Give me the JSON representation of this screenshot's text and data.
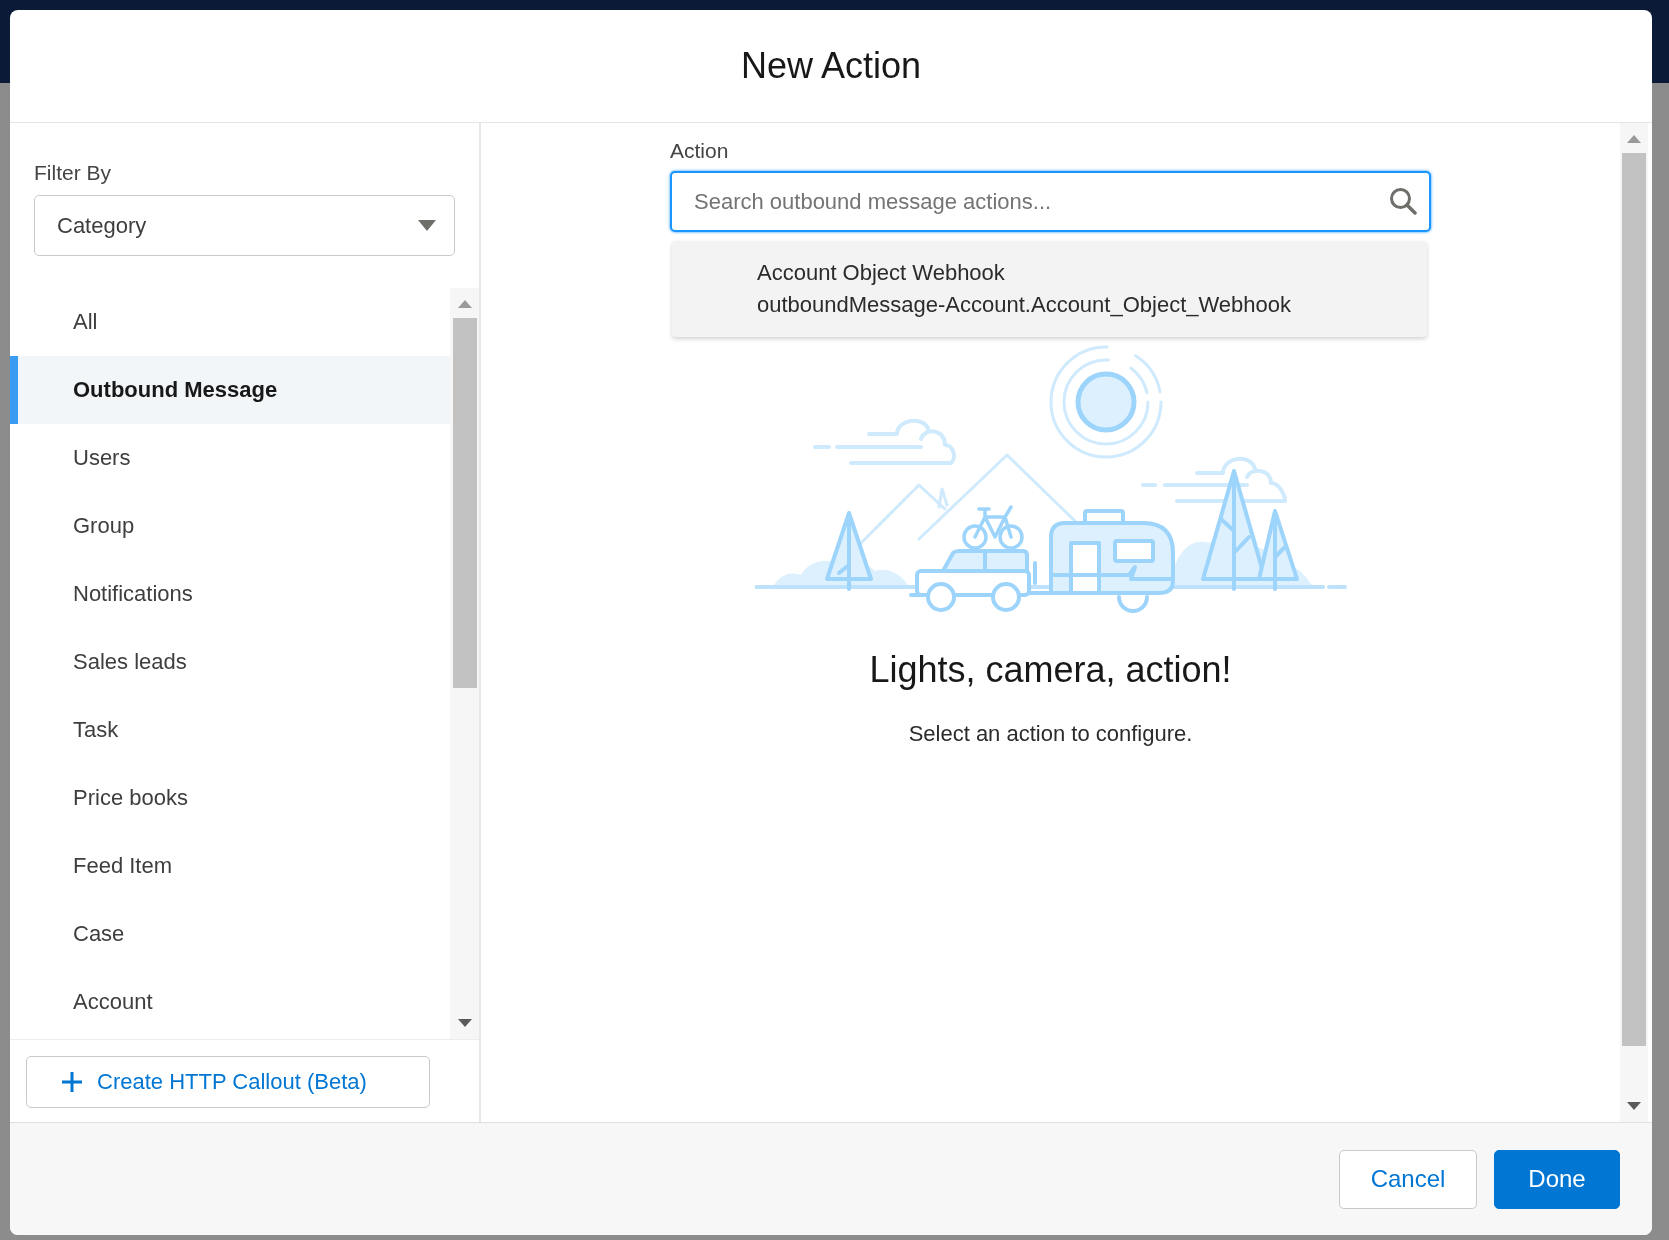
{
  "window": {
    "title": "New Action"
  },
  "sidebar": {
    "filter_label": "Filter By",
    "filter_select": {
      "value": "Category"
    },
    "items": [
      {
        "label": "All",
        "selected": false
      },
      {
        "label": "Outbound Message",
        "selected": true
      },
      {
        "label": "Users",
        "selected": false
      },
      {
        "label": "Group",
        "selected": false
      },
      {
        "label": "Notifications",
        "selected": false
      },
      {
        "label": "Sales leads",
        "selected": false
      },
      {
        "label": "Task",
        "selected": false
      },
      {
        "label": "Price books",
        "selected": false
      },
      {
        "label": "Feed Item",
        "selected": false
      },
      {
        "label": "Case",
        "selected": false
      },
      {
        "label": "Account",
        "selected": false
      }
    ],
    "create_button": {
      "label": "Create HTTP Callout (Beta)"
    }
  },
  "action": {
    "label": "Action",
    "search": {
      "placeholder": "Search outbound message actions..."
    },
    "results": [
      {
        "title": "Account Object Webhook",
        "subtitle": "outboundMessage-Account.Account_Object_Webhook"
      }
    ]
  },
  "empty_state": {
    "heading": "Lights, camera, action!",
    "message": "Select an action to configure."
  },
  "footer": {
    "buttons": [
      {
        "label": "Cancel",
        "kind": "neutral"
      },
      {
        "label": "Done",
        "kind": "brand"
      }
    ]
  }
}
